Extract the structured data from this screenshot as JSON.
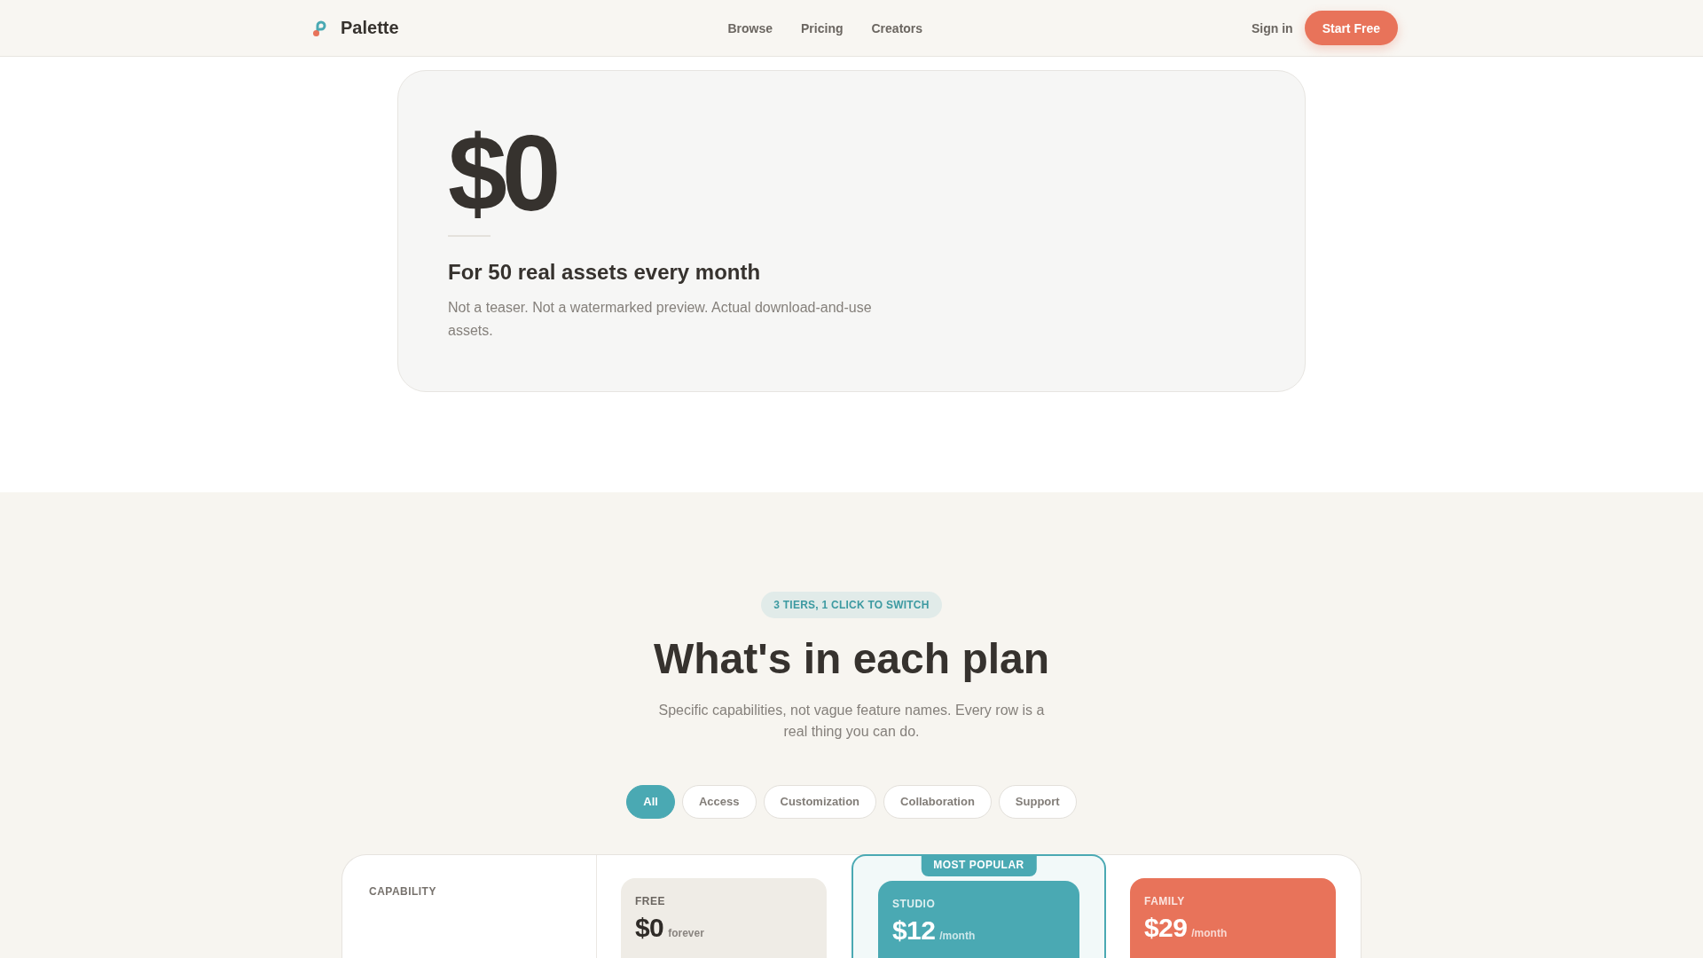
{
  "nav": {
    "brand": "Palette",
    "links": [
      {
        "label": "Browse"
      },
      {
        "label": "Pricing"
      },
      {
        "label": "Creators"
      }
    ],
    "sign_in": "Sign in",
    "cta": "Start Free"
  },
  "hero_card": {
    "price": "$0",
    "heading": "For 50 real assets every month",
    "text": "Not a teaser. Not a watermarked preview. Actual download-and-use assets."
  },
  "plans": {
    "eyebrow": "3 TIERS, 1 CLICK TO SWITCH",
    "title": "What's in each plan",
    "subtitle": "Specific capabilities, not vague feature names. Every row is a real thing you can do.",
    "filters": [
      {
        "label": "All",
        "selected": true
      },
      {
        "label": "Access",
        "selected": false
      },
      {
        "label": "Customization",
        "selected": false
      },
      {
        "label": "Collaboration",
        "selected": false
      },
      {
        "label": "Support",
        "selected": false
      }
    ],
    "table": {
      "first_column": "CAPABILITY",
      "columns": [
        {
          "name": "FREE",
          "price": "$0",
          "period": "forever",
          "color": "#efece6",
          "highlighted": false
        },
        {
          "name": "STUDIO",
          "price": "$12",
          "period": "/month",
          "color": "#4aa9b3",
          "highlighted": true,
          "ribbon": "MOST POPULAR"
        },
        {
          "name": "FAMILY",
          "price": "$29",
          "period": "/month",
          "color": "#e8735a",
          "highlighted": false
        }
      ]
    }
  }
}
